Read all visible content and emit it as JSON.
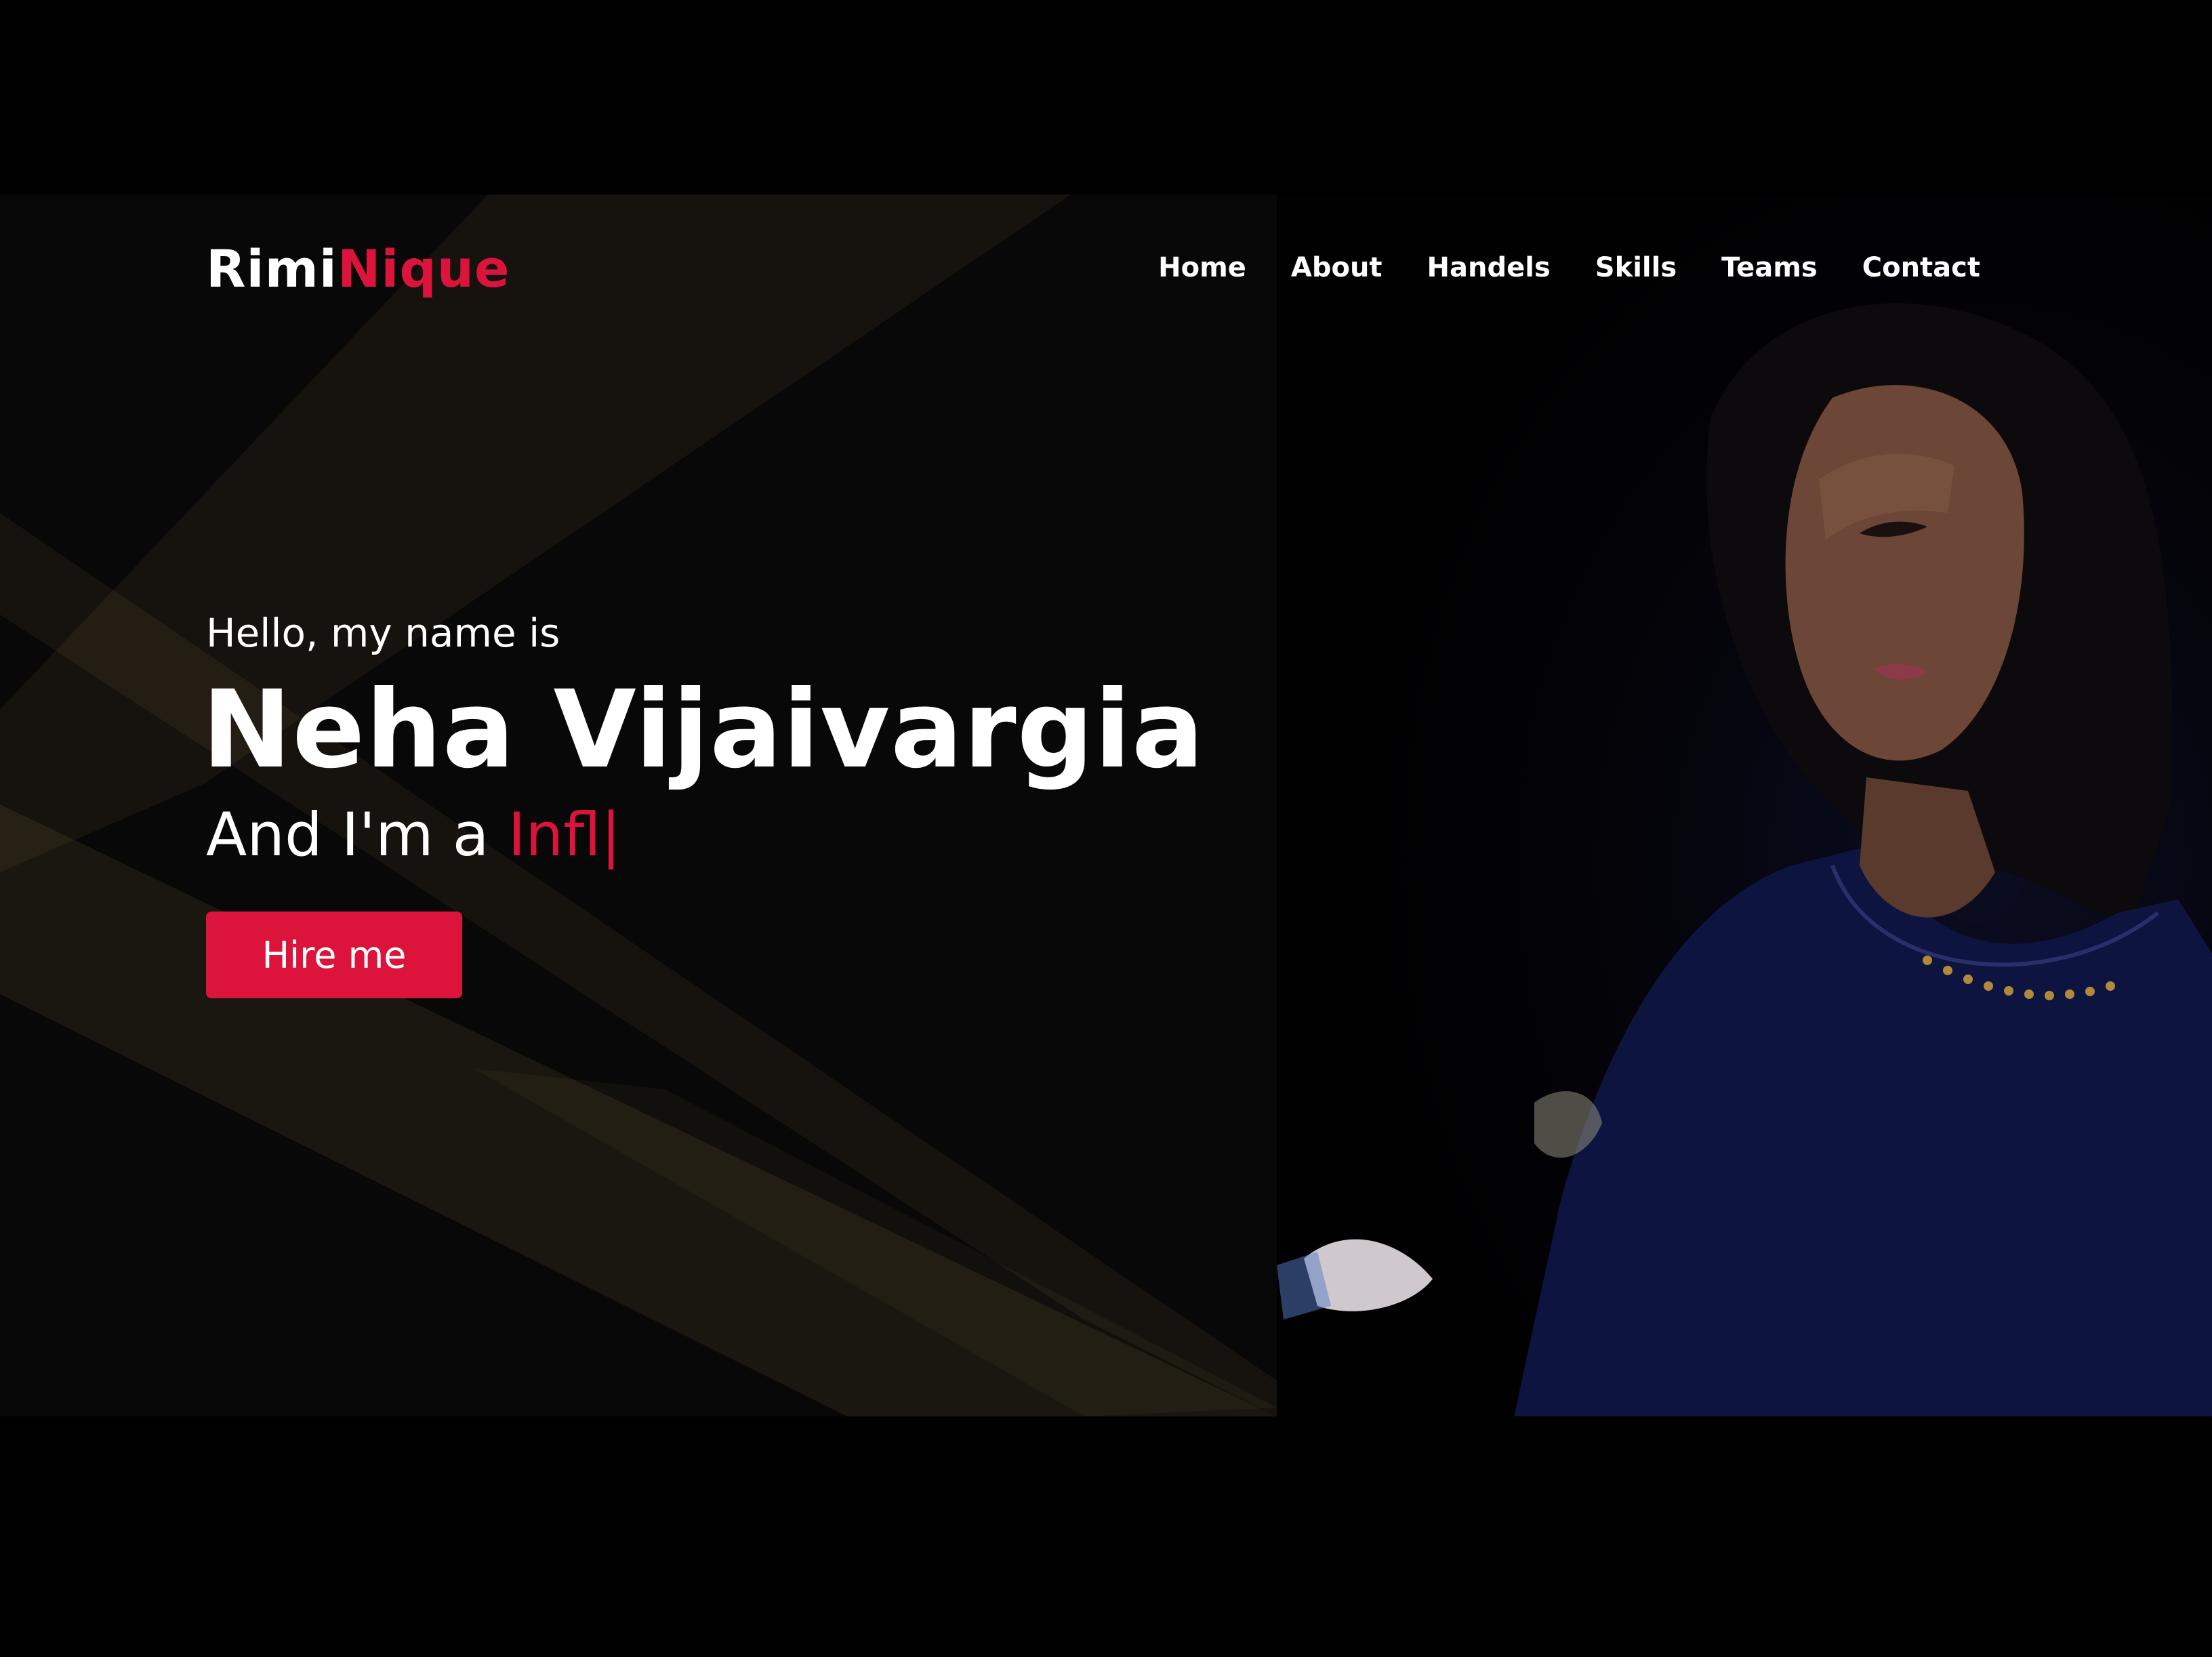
{
  "brand": {
    "part1": "Rimi",
    "part2": "Nique",
    "accent_color": "#dc143c"
  },
  "nav": {
    "items": [
      {
        "label": "Home"
      },
      {
        "label": "About"
      },
      {
        "label": "Handels"
      },
      {
        "label": "Skills"
      },
      {
        "label": "Teams"
      },
      {
        "label": "Contact"
      }
    ]
  },
  "hero": {
    "greeting": "Hello, my name is",
    "name": "Neha Vijaivargia",
    "role_prefix": "And I'm a ",
    "role_typed": "Infl",
    "cursor": "|",
    "cta_label": "Hire me"
  }
}
